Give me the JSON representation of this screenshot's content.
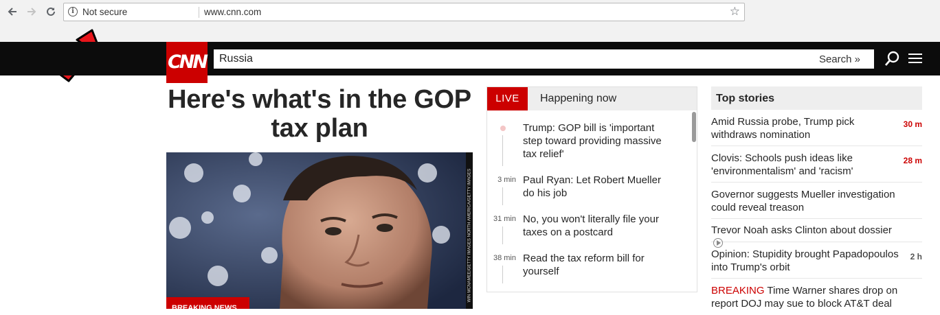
{
  "browser": {
    "security_label": "Not secure",
    "url": "www.cnn.com",
    "back_icon": "arrow-left-icon",
    "forward_icon": "arrow-right-icon",
    "reload_icon": "reload-icon",
    "bookmark_icon": "star-icon"
  },
  "header": {
    "logo_text": "CNN",
    "search_query": "Russia",
    "search_button": "Search »"
  },
  "main": {
    "headline": "Here's what's in the GOP tax plan",
    "photo_credit": "WIN MCNAMEE/GETTY IMAGES NORTH AMERICA/GETTY IMAGES",
    "breaking_badge": "BREAKING NEWS"
  },
  "live": {
    "tag": "LIVE",
    "title": "Happening now",
    "items": [
      {
        "time": "",
        "text": "Trump: GOP bill is 'important step toward providing massive tax relief'"
      },
      {
        "time": "3 min",
        "text": "Paul Ryan: Let Robert Mueller do his job"
      },
      {
        "time": "31 min",
        "text": "No, you won't literally file your taxes on a postcard"
      },
      {
        "time": "38 min",
        "text": "Read the tax reform bill for yourself"
      }
    ]
  },
  "top_stories": {
    "title": "Top stories",
    "items": [
      {
        "text": "Amid Russia probe, Trump pick withdraws nomination",
        "age": "30 m"
      },
      {
        "text": "Clovis: Schools push ideas like 'environmentalism' and 'racism'",
        "age": "28 m"
      },
      {
        "text": "Governor suggests Mueller investigation could reveal treason",
        "age": ""
      },
      {
        "text": "Trevor Noah asks Clinton about dossier",
        "age": ""
      },
      {
        "text": "Opinion: Stupidity brought Papadopoulos into Trump's orbit",
        "age": "2 h"
      },
      {
        "prefix": "BREAKING",
        "text": " Time Warner shares drop on report DOJ may sue to block AT&T deal",
        "age": ""
      }
    ]
  },
  "colors": {
    "cnn_red": "#cc0000",
    "header_black": "#0c0c0c",
    "panel_gray": "#eeeeee"
  }
}
